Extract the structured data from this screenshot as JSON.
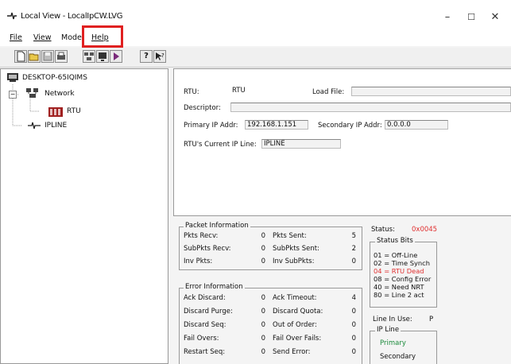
{
  "window": {
    "title": "Local View - LocalIpCW.LVG",
    "minimize": "–",
    "maximize": "☐",
    "close": "✕"
  },
  "menu": {
    "file": "File",
    "view": "View",
    "mode": "Mode",
    "help": "Help"
  },
  "tree": {
    "computer": "DESKTOP-65IQIMS",
    "network": "Network",
    "rtu": "RTU",
    "ipline": "IPLINE"
  },
  "rtu_info": {
    "rtu_label": "RTU:",
    "rtu_value": "RTU",
    "load_file_label": "Load File:",
    "load_file_value": "",
    "descriptor_label": "Descriptor:",
    "descriptor_value": "",
    "primary_ip_label": "Primary IP Addr:",
    "primary_ip_value": "192.168.1.151",
    "secondary_ip_label": "Secondary IP Addr:",
    "secondary_ip_value": "0.0.0.0",
    "current_ip_line_label": "RTU's Current IP Line:",
    "current_ip_line_value": "IPLINE"
  },
  "packet_info": {
    "title": "Packet Information",
    "rows": [
      {
        "l_label": "Pkts Recv:",
        "l_value": "0",
        "r_label": "Pkts Sent:",
        "r_value": "5"
      },
      {
        "l_label": "SubPkts Recv:",
        "l_value": "0",
        "r_label": "SubPkts Sent:",
        "r_value": "2"
      },
      {
        "l_label": "Inv Pkts:",
        "l_value": "0",
        "r_label": "Inv SubPkts:",
        "r_value": "0"
      }
    ]
  },
  "error_info": {
    "title": "Error Information",
    "rows": [
      {
        "l_label": "Ack Discard:",
        "l_value": "0",
        "r_label": "Ack Timeout:",
        "r_value": "4"
      },
      {
        "l_label": "Discard Purge:",
        "l_value": "0",
        "r_label": "Discard Quota:",
        "r_value": "0"
      },
      {
        "l_label": "Discard Seq:",
        "l_value": "0",
        "r_label": "Out of Order:",
        "r_value": "0"
      },
      {
        "l_label": "Fail Overs:",
        "l_value": "0",
        "r_label": "Fail Over Fails:",
        "r_value": "0"
      },
      {
        "l_label": "Restart Seq:",
        "l_value": "0",
        "r_label": "Send Error:",
        "r_value": "0"
      }
    ]
  },
  "status": {
    "label": "Status:",
    "value": "0x0045",
    "value_color": "#e03030",
    "bits_title": "Status Bits",
    "bits": [
      {
        "text": "01 = Off-Line",
        "color": "#111111"
      },
      {
        "text": "02 = Time Synch",
        "color": "#111111"
      },
      {
        "text": "04 = RTU Dead",
        "color": "#e03030"
      },
      {
        "text": "08 = Config Error",
        "color": "#111111"
      },
      {
        "text": "40 = Need NRT",
        "color": "#111111"
      },
      {
        "text": "80 = Line 2 act",
        "color": "#111111"
      }
    ]
  },
  "line_in_use": {
    "label": "Line In Use:",
    "value": "P"
  },
  "ip_line": {
    "title": "IP Line",
    "primary": "Primary",
    "secondary": "Secondary",
    "primary_color": "#1a8a3a"
  }
}
